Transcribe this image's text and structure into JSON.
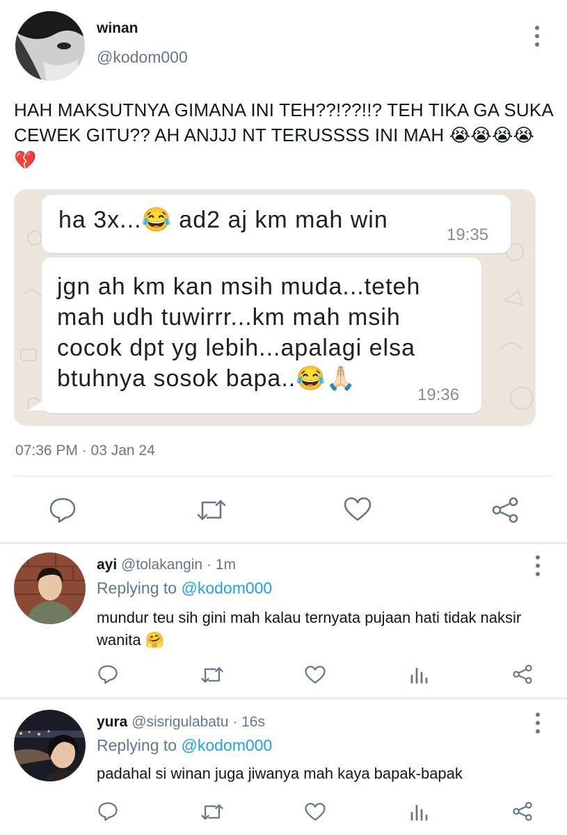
{
  "tweet": {
    "author_name": "winan",
    "author_handle": "@kodom000",
    "text": "HAH MAKSUTNYA GIMANA INI TEH??!??!!? TEH TIKA GA SUKA CEWEK GITU?? AH ANJJJ NT TERUSSSS INI MAH 😭😭😭😭💔",
    "timestamp": "07:36 PM · 03 Jan 24",
    "image": {
      "messages": [
        {
          "text": "ha 3x...😂 ad2 aj km mah win",
          "time": "19:35"
        },
        {
          "text": "jgn ah km kan msih muda...teteh mah udh tuwirrr...km mah msih cocok dpt yg lebih...apalagi elsa btuhnya sosok bapa..😂🙏🏻",
          "time": "19:36"
        }
      ]
    },
    "actions": [
      "reply-icon",
      "retweet-icon",
      "like-icon",
      "share-icon"
    ]
  },
  "replies": [
    {
      "name": "ayi",
      "handle": "@tolakangin",
      "age": "· 1m",
      "replying_prefix": "Replying to",
      "replying_to": "@kodom000",
      "text": "mundur teu sih gini mah kalau ternyata pujaan hati tidak naksir wanita 🤗"
    },
    {
      "name": "yura",
      "handle": "@sisrigulabatu",
      "age": "· 16s",
      "replying_prefix": "Replying to",
      "replying_to": "@kodom000",
      "text": "padahal si winan juga jiwanya mah kaya bapak-bapak"
    }
  ],
  "colors": {
    "accent": "#1da1f2",
    "secondary_text": "#657786",
    "icon": "#657786",
    "chat_background": "#ece5dd"
  }
}
